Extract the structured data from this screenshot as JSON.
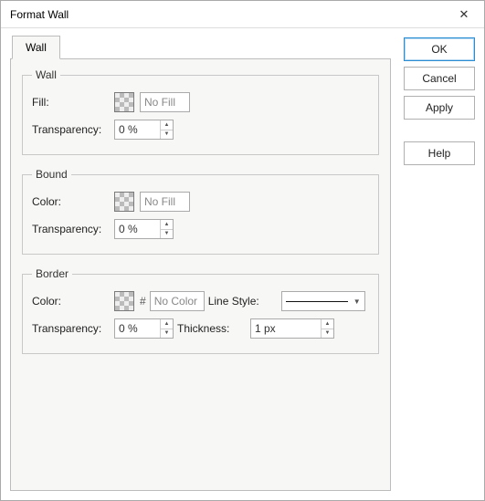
{
  "window": {
    "title": "Format Wall"
  },
  "tabs": {
    "wall": "Wall"
  },
  "groups": {
    "wall": {
      "legend": "Wall",
      "fill_label": "Fill:",
      "fill_value": "No Fill",
      "transparency_label": "Transparency:",
      "transparency_value": "0 %"
    },
    "bound": {
      "legend": "Bound",
      "color_label": "Color:",
      "color_value": "No Fill",
      "transparency_label": "Transparency:",
      "transparency_value": "0 %"
    },
    "border": {
      "legend": "Border",
      "color_label": "Color:",
      "color_value": "No Color",
      "transparency_label": "Transparency:",
      "transparency_value": "0 %",
      "linestyle_label": "Line Style:",
      "thickness_label": "Thickness:",
      "thickness_value": "1 px"
    }
  },
  "buttons": {
    "ok": "OK",
    "cancel": "Cancel",
    "apply": "Apply",
    "help": "Help"
  }
}
